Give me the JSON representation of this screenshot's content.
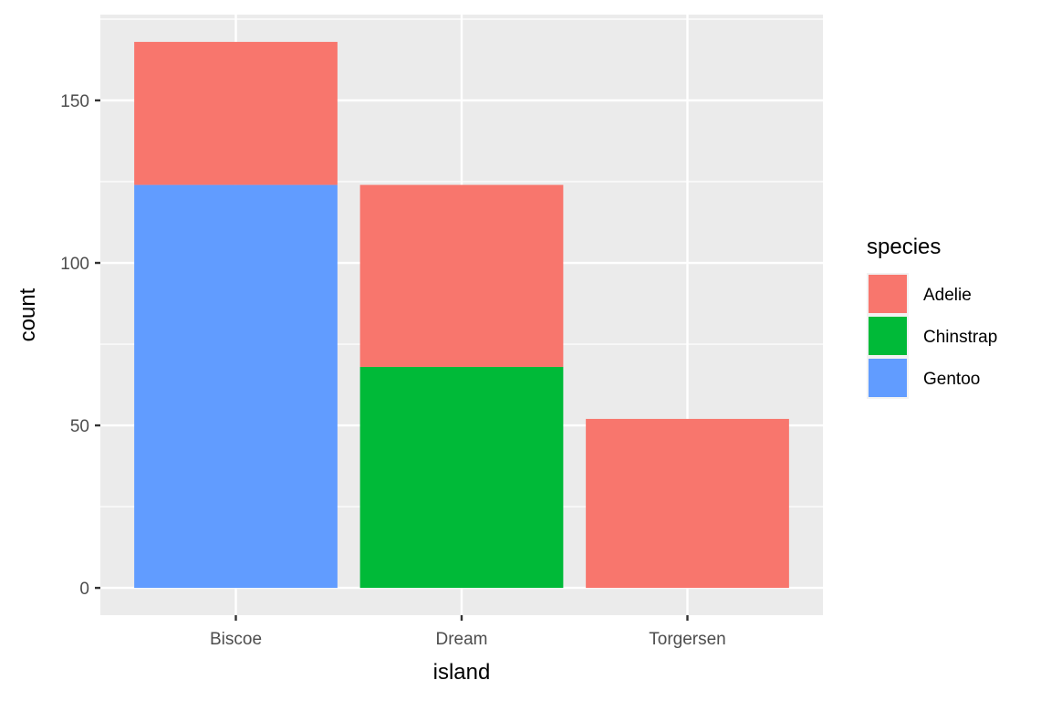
{
  "chart_data": {
    "type": "bar",
    "stacked": true,
    "title": "",
    "xlabel": "island",
    "ylabel": "count",
    "categories": [
      "Biscoe",
      "Dream",
      "Torgersen"
    ],
    "series": [
      {
        "name": "Adelie",
        "color": "#F8766D",
        "values": [
          44,
          56,
          52
        ]
      },
      {
        "name": "Chinstrap",
        "color": "#00BA38",
        "values": [
          0,
          68,
          0
        ]
      },
      {
        "name": "Gentoo",
        "color": "#619CFF",
        "values": [
          124,
          0,
          0
        ]
      }
    ],
    "stack_order_bottom_to_top": [
      "Gentoo",
      "Chinstrap",
      "Adelie"
    ],
    "ylim": [
      -8.4,
      176.4
    ],
    "y_ticks": [
      0,
      50,
      100,
      150
    ],
    "y_tick_labels": [
      "0",
      "50",
      "100",
      "150"
    ],
    "y_minor_ticks": [
      25,
      75,
      125,
      175
    ],
    "grid": true,
    "legend": {
      "title": "species",
      "position": "right",
      "entries": [
        "Adelie",
        "Chinstrap",
        "Gentoo"
      ]
    },
    "theme": {
      "panel_background": "#EBEBEB",
      "grid_color": "#FFFFFF",
      "tick_color": "#333333"
    }
  }
}
